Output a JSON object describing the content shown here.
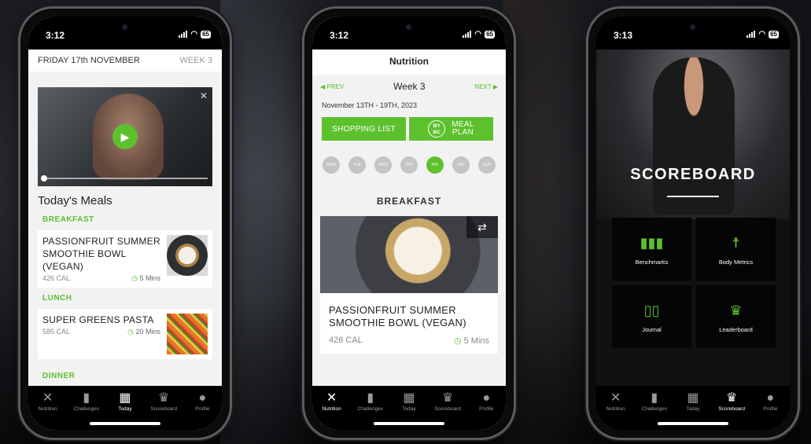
{
  "status": {
    "phone1_time": "3:12",
    "phone2_time": "3:12",
    "phone3_time": "3:13",
    "battery": "65"
  },
  "tabs": [
    {
      "label": "Nutrition",
      "icon": "fork-knife-icon"
    },
    {
      "label": "Challenges",
      "icon": "bar-chart-icon"
    },
    {
      "label": "Today",
      "icon": "calendar-icon"
    },
    {
      "label": "Scoreboard",
      "icon": "trophy-icon"
    },
    {
      "label": "Profile",
      "icon": "person-icon"
    }
  ],
  "today": {
    "date": "FRIDAY 17th NOVEMBER",
    "week": "WEEK 3",
    "heading": "Today's Meals",
    "breakfast_label": "BREAKFAST",
    "breakfast_title": "PASSIONFRUIT SUMMER SMOOTHIE BOWL (VEGAN)",
    "breakfast_cal": "426 CAL",
    "breakfast_time": "5 Mins",
    "lunch_label": "LUNCH",
    "lunch_title": "SUPER GREENS PASTA",
    "lunch_cal": "585 CAL",
    "lunch_time": "20 Mins",
    "dinner_label": "DINNER"
  },
  "nutrition": {
    "title": "Nutrition",
    "prev": "PREV",
    "week": "Week 3",
    "next": "NEXT",
    "date_range": "November 13TH - 19TH, 2023",
    "shopping_list": "SHOPPING LIST",
    "mymc": "MY MC",
    "meal_plan_1": "MEAL",
    "meal_plan_2": "PLAN",
    "days": [
      "MON",
      "TUE",
      "WED",
      "THU",
      "FRI",
      "SAT",
      "SUN"
    ],
    "active_day": "FRI",
    "section": "BREAKFAST",
    "meal_title": "PASSIONFRUIT SUMMER SMOOTHIE BOWL (VEGAN)",
    "meal_cal": "426 CAL",
    "meal_time": "5 Mins"
  },
  "scoreboard": {
    "title": "SCOREBOARD",
    "tiles": [
      {
        "label": "Benchmarks",
        "icon": "bar-chart-icon"
      },
      {
        "label": "Body Metrics",
        "icon": "body-icon"
      },
      {
        "label": "Journal",
        "icon": "book-icon"
      },
      {
        "label": "Leaderboard",
        "icon": "trophy-icon"
      }
    ]
  },
  "colors": {
    "accent": "#5dc12e",
    "dark": "#000000",
    "light_bg": "#f2f2f2"
  }
}
